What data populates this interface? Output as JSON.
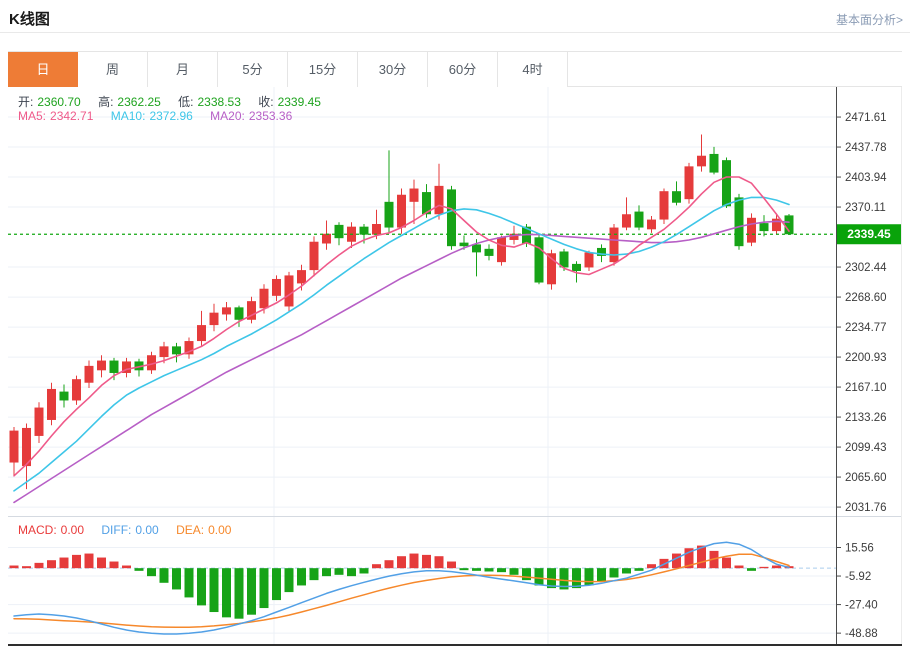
{
  "page": {
    "title": "K线图",
    "link_label": "基本面分析>"
  },
  "tabs": [
    {
      "label": "日",
      "active": true
    },
    {
      "label": "周"
    },
    {
      "label": "月"
    },
    {
      "label": "5分"
    },
    {
      "label": "15分"
    },
    {
      "label": "30分"
    },
    {
      "label": "60分"
    },
    {
      "label": "4时"
    }
  ],
  "ohlc_bar": {
    "open_label": "开:",
    "open": "2360.70",
    "high_label": "高:",
    "high": "2362.25",
    "low_label": "低:",
    "low": "2338.53",
    "close_label": "收:",
    "close": "2339.45"
  },
  "ma_bar": {
    "ma5_label": "MA5:",
    "ma5": "2342.71",
    "ma10_label": "MA10:",
    "ma10": "2372.96",
    "ma20_label": "MA20:",
    "ma20": "2353.36"
  },
  "macd_bar": {
    "macd_label": "MACD:",
    "macd": "0.00",
    "diff_label": "DIFF:",
    "diff": "0.00",
    "dea_label": "DEA:",
    "dea": "0.00"
  },
  "colors": {
    "accent_tab": "#ee7c36",
    "up": "#e53b3b",
    "down": "#17a317",
    "ma5": "#ef5a8a",
    "ma10": "#3ec6e8",
    "ma20": "#b75fc6",
    "diff": "#52a0e6",
    "dea": "#f6882b",
    "grid": "#edf1f7",
    "axis": "#4a4a4a",
    "price_line": "#12a812",
    "price_tag": "#09a30a",
    "zero_line": "#aacdee",
    "pane_divider": "#d5dae1"
  },
  "chart_data": {
    "type": "candlestick+macd",
    "title": "K线图",
    "legend": [
      "MA5",
      "MA10",
      "MA20",
      "MACD",
      "DIFF",
      "DEA"
    ],
    "grid": true,
    "current_price": 2339.45,
    "main_top": 2505.5,
    "main_bottom": 2021.7,
    "macd_top": 38.5,
    "macd_bottom": -57.8,
    "y_ticks_main": [
      2471.61,
      2437.78,
      2403.94,
      2370.11,
      2302.44,
      2268.6,
      2234.77,
      2200.93,
      2167.1,
      2133.26,
      2099.43,
      2065.6,
      2031.76
    ],
    "y_ticks_macd": [
      15.56,
      -5.92,
      -27.4,
      -48.88
    ],
    "candles": [
      [
        2082,
        2122,
        2068,
        2118
      ],
      [
        2078,
        2126,
        2052,
        2121
      ],
      [
        2112,
        2150,
        2104,
        2144
      ],
      [
        2130,
        2172,
        2124,
        2165
      ],
      [
        2162,
        2170,
        2144,
        2152
      ],
      [
        2152,
        2180,
        2147,
        2176
      ],
      [
        2172,
        2197,
        2166,
        2191
      ],
      [
        2186,
        2203,
        2178,
        2197
      ],
      [
        2197,
        2200,
        2175,
        2183
      ],
      [
        2183,
        2200,
        2178,
        2196
      ],
      [
        2196,
        2199,
        2179,
        2186
      ],
      [
        2186,
        2207,
        2182,
        2203
      ],
      [
        2201,
        2218,
        2194,
        2213
      ],
      [
        2213,
        2217,
        2195,
        2204
      ],
      [
        2204,
        2223,
        2199,
        2219
      ],
      [
        2219,
        2253,
        2214,
        2237
      ],
      [
        2237,
        2261,
        2230,
        2251
      ],
      [
        2249,
        2263,
        2242,
        2257
      ],
      [
        2257,
        2259,
        2235,
        2243
      ],
      [
        2243,
        2269,
        2239,
        2264
      ],
      [
        2256,
        2283,
        2250,
        2278
      ],
      [
        2270,
        2293,
        2264,
        2289
      ],
      [
        2258,
        2297,
        2252,
        2293
      ],
      [
        2284,
        2305,
        2276,
        2299
      ],
      [
        2299,
        2337,
        2292,
        2331
      ],
      [
        2329,
        2355,
        2322,
        2340
      ],
      [
        2350,
        2353,
        2327,
        2335
      ],
      [
        2331,
        2353,
        2324,
        2348
      ],
      [
        2348,
        2351,
        2329,
        2339
      ],
      [
        2339,
        2367,
        2334,
        2351
      ],
      [
        2376,
        2434,
        2341,
        2347
      ],
      [
        2347,
        2391,
        2340,
        2384
      ],
      [
        2376,
        2401,
        2351,
        2391
      ],
      [
        2387,
        2396,
        2358,
        2362
      ],
      [
        2362,
        2419,
        2356,
        2394
      ],
      [
        2390,
        2394,
        2322,
        2326
      ],
      [
        2330,
        2338,
        2322,
        2326
      ],
      [
        2328,
        2334,
        2292,
        2319
      ],
      [
        2323,
        2328,
        2310,
        2315
      ],
      [
        2308,
        2338,
        2304,
        2336
      ],
      [
        2333,
        2349,
        2328,
        2340
      ],
      [
        2348,
        2351,
        2325,
        2329
      ],
      [
        2336,
        2339,
        2283,
        2285
      ],
      [
        2283,
        2322,
        2277,
        2318
      ],
      [
        2320,
        2323,
        2298,
        2302
      ],
      [
        2306,
        2309,
        2285,
        2298
      ],
      [
        2302,
        2321,
        2298,
        2319
      ],
      [
        2324,
        2328,
        2308,
        2315
      ],
      [
        2308,
        2351,
        2304,
        2347
      ],
      [
        2347,
        2381,
        2344,
        2362
      ],
      [
        2365,
        2372,
        2344,
        2347
      ],
      [
        2345,
        2360,
        2341,
        2356
      ],
      [
        2356,
        2391,
        2351,
        2388
      ],
      [
        2388,
        2399,
        2372,
        2375
      ],
      [
        2379,
        2420,
        2374,
        2416
      ],
      [
        2416,
        2452,
        2410,
        2428
      ],
      [
        2430,
        2438,
        2407,
        2409
      ],
      [
        2423,
        2426,
        2369,
        2371
      ],
      [
        2381,
        2385,
        2322,
        2326
      ],
      [
        2330,
        2363,
        2326,
        2358
      ],
      [
        2352,
        2361,
        2337,
        2343
      ],
      [
        2343,
        2363,
        2339,
        2357
      ],
      [
        2360.7,
        2362.25,
        2338.53,
        2339.45
      ]
    ],
    "ma5": [
      2067,
      2080,
      2095,
      2112,
      2128,
      2142,
      2155,
      2169,
      2180,
      2187,
      2190,
      2193,
      2197,
      2202,
      2207,
      2213,
      2222,
      2232,
      2241,
      2248,
      2255,
      2262,
      2271,
      2281,
      2293,
      2305,
      2316,
      2326,
      2333,
      2338,
      2341,
      2347,
      2355,
      2364,
      2372,
      2368,
      2355,
      2342,
      2333,
      2327,
      2325,
      2330,
      2324,
      2312,
      2301,
      2296,
      2294,
      2300,
      2306,
      2315,
      2327,
      2336,
      2345,
      2357,
      2370,
      2385,
      2398,
      2404,
      2404,
      2397,
      2380,
      2362,
      2343
    ],
    "ma10": [
      2050,
      2060,
      2070,
      2082,
      2094,
      2106,
      2120,
      2134,
      2147,
      2158,
      2166,
      2173,
      2180,
      2186,
      2192,
      2198,
      2205,
      2213,
      2220,
      2227,
      2235,
      2243,
      2252,
      2261,
      2271,
      2282,
      2292,
      2302,
      2312,
      2321,
      2330,
      2338,
      2346,
      2354,
      2361,
      2366,
      2368,
      2367,
      2363,
      2358,
      2352,
      2346,
      2340,
      2334,
      2328,
      2323,
      2319,
      2317,
      2316,
      2317,
      2320,
      2325,
      2331,
      2339,
      2348,
      2357,
      2366,
      2373,
      2378,
      2381,
      2381,
      2378,
      2373
    ],
    "ma20": [
      2037,
      2046,
      2055,
      2064,
      2073,
      2082,
      2091,
      2100,
      2109,
      2118,
      2127,
      2136,
      2144,
      2152,
      2160,
      2168,
      2176,
      2184,
      2191,
      2198,
      2205,
      2212,
      2219,
      2226,
      2234,
      2242,
      2250,
      2258,
      2266,
      2274,
      2282,
      2290,
      2297,
      2304,
      2311,
      2318,
      2324,
      2329,
      2333,
      2336,
      2338,
      2339,
      2339,
      2338,
      2337,
      2336,
      2335,
      2334,
      2333,
      2332,
      2331,
      2330,
      2330,
      2331,
      2333,
      2336,
      2340,
      2344,
      2348,
      2351,
      2353,
      2354,
      2353
    ],
    "macd_hist": [
      2,
      1.5,
      4,
      6,
      8,
      10,
      11,
      8,
      5,
      2,
      -2,
      -6,
      -11,
      -16,
      -22,
      -28,
      -33,
      -37,
      -38,
      -35,
      -30,
      -24,
      -18,
      -13,
      -9,
      -6,
      -5,
      -6,
      -4,
      3,
      6,
      9,
      11,
      10,
      9,
      5,
      -1.5,
      -2,
      -2.5,
      -3,
      -5,
      -9,
      -13,
      -15,
      -16,
      -15,
      -13,
      -10,
      -7,
      -4,
      -2,
      3,
      7,
      11,
      15,
      17,
      13,
      8,
      2,
      -2,
      1,
      2,
      1.5
    ],
    "diff": [
      -36,
      -35,
      -34.5,
      -35,
      -36,
      -37.5,
      -39.5,
      -42,
      -44.5,
      -46.5,
      -48,
      -49,
      -49.5,
      -49.5,
      -49,
      -48,
      -46.5,
      -44.5,
      -42,
      -39.5,
      -36.5,
      -33,
      -29.5,
      -26,
      -22.5,
      -19,
      -16,
      -13.2,
      -10.6,
      -8.2,
      -6,
      -4.2,
      -2.8,
      -2,
      -2,
      -2.6,
      -3.8,
      -5.2,
      -6.8,
      -8.2,
      -9.6,
      -11,
      -12.4,
      -13.4,
      -13.8,
      -13.6,
      -12.8,
      -11.4,
      -9.4,
      -7.5,
      -4.5,
      -1.5,
      3,
      7.5,
      12,
      15.5,
      18.5,
      19.5,
      18,
      14,
      8,
      3,
      0.5
    ],
    "dea": [
      -38,
      -38.2,
      -38.5,
      -39,
      -39.5,
      -40,
      -40.5,
      -41.2,
      -42,
      -42.8,
      -43.5,
      -44,
      -44.3,
      -44.5,
      -44.4,
      -44,
      -43.4,
      -42.6,
      -41.6,
      -40.4,
      -39,
      -37.3,
      -35.3,
      -33,
      -30.5,
      -28,
      -25.3,
      -22.6,
      -20,
      -17.4,
      -15,
      -12.8,
      -10.8,
      -9.2,
      -7.8,
      -6.6,
      -5.8,
      -5.4,
      -5.3,
      -5.5,
      -6,
      -6.7,
      -7.5,
      -8.4,
      -9.2,
      -9.8,
      -10.1,
      -10,
      -9.5,
      -8.5,
      -7,
      -5,
      -2.8,
      -0.5,
      2,
      4.5,
      7,
      9,
      10.5,
      10.5,
      8,
      5,
      2
    ]
  }
}
